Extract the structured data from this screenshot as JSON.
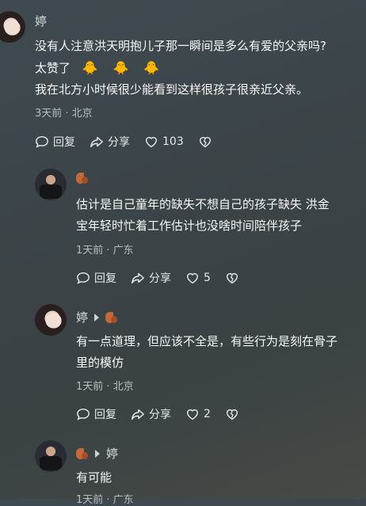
{
  "comments": [
    {
      "author": "婷",
      "lines": [
        "没有人注意洪天明抱儿子那一瞬间是多么有爱的父亲吗?",
        "太赞了",
        "我在北方小时候很少能看到这样很孩子很亲近父亲。"
      ],
      "emojis": [
        "🐥",
        "🐥",
        "🐥"
      ],
      "meta": "3天前 · 北京",
      "reply_label": "回复",
      "share_label": "分享",
      "likes": "103"
    },
    {
      "author": "",
      "lines": [
        "估计是自己童年的缺失不想自己的孩子缺失 洪金",
        "宝年轻时忙着工作估计也没啥时间陪伴孩子"
      ],
      "meta": "1天前 · 广东",
      "reply_label": "回复",
      "share_label": "分享",
      "likes": "5"
    },
    {
      "author": "婷",
      "lines": [
        "有一点道理，但应该不全是，有些行为是刻在骨子",
        "里的模仿"
      ],
      "meta": "1天前 · 北京",
      "reply_label": "回复",
      "share_label": "分享",
      "likes": "2"
    },
    {
      "author": "",
      "reply_to": "婷",
      "lines": [
        "有可能"
      ],
      "meta": "1天前 · 广东"
    }
  ]
}
